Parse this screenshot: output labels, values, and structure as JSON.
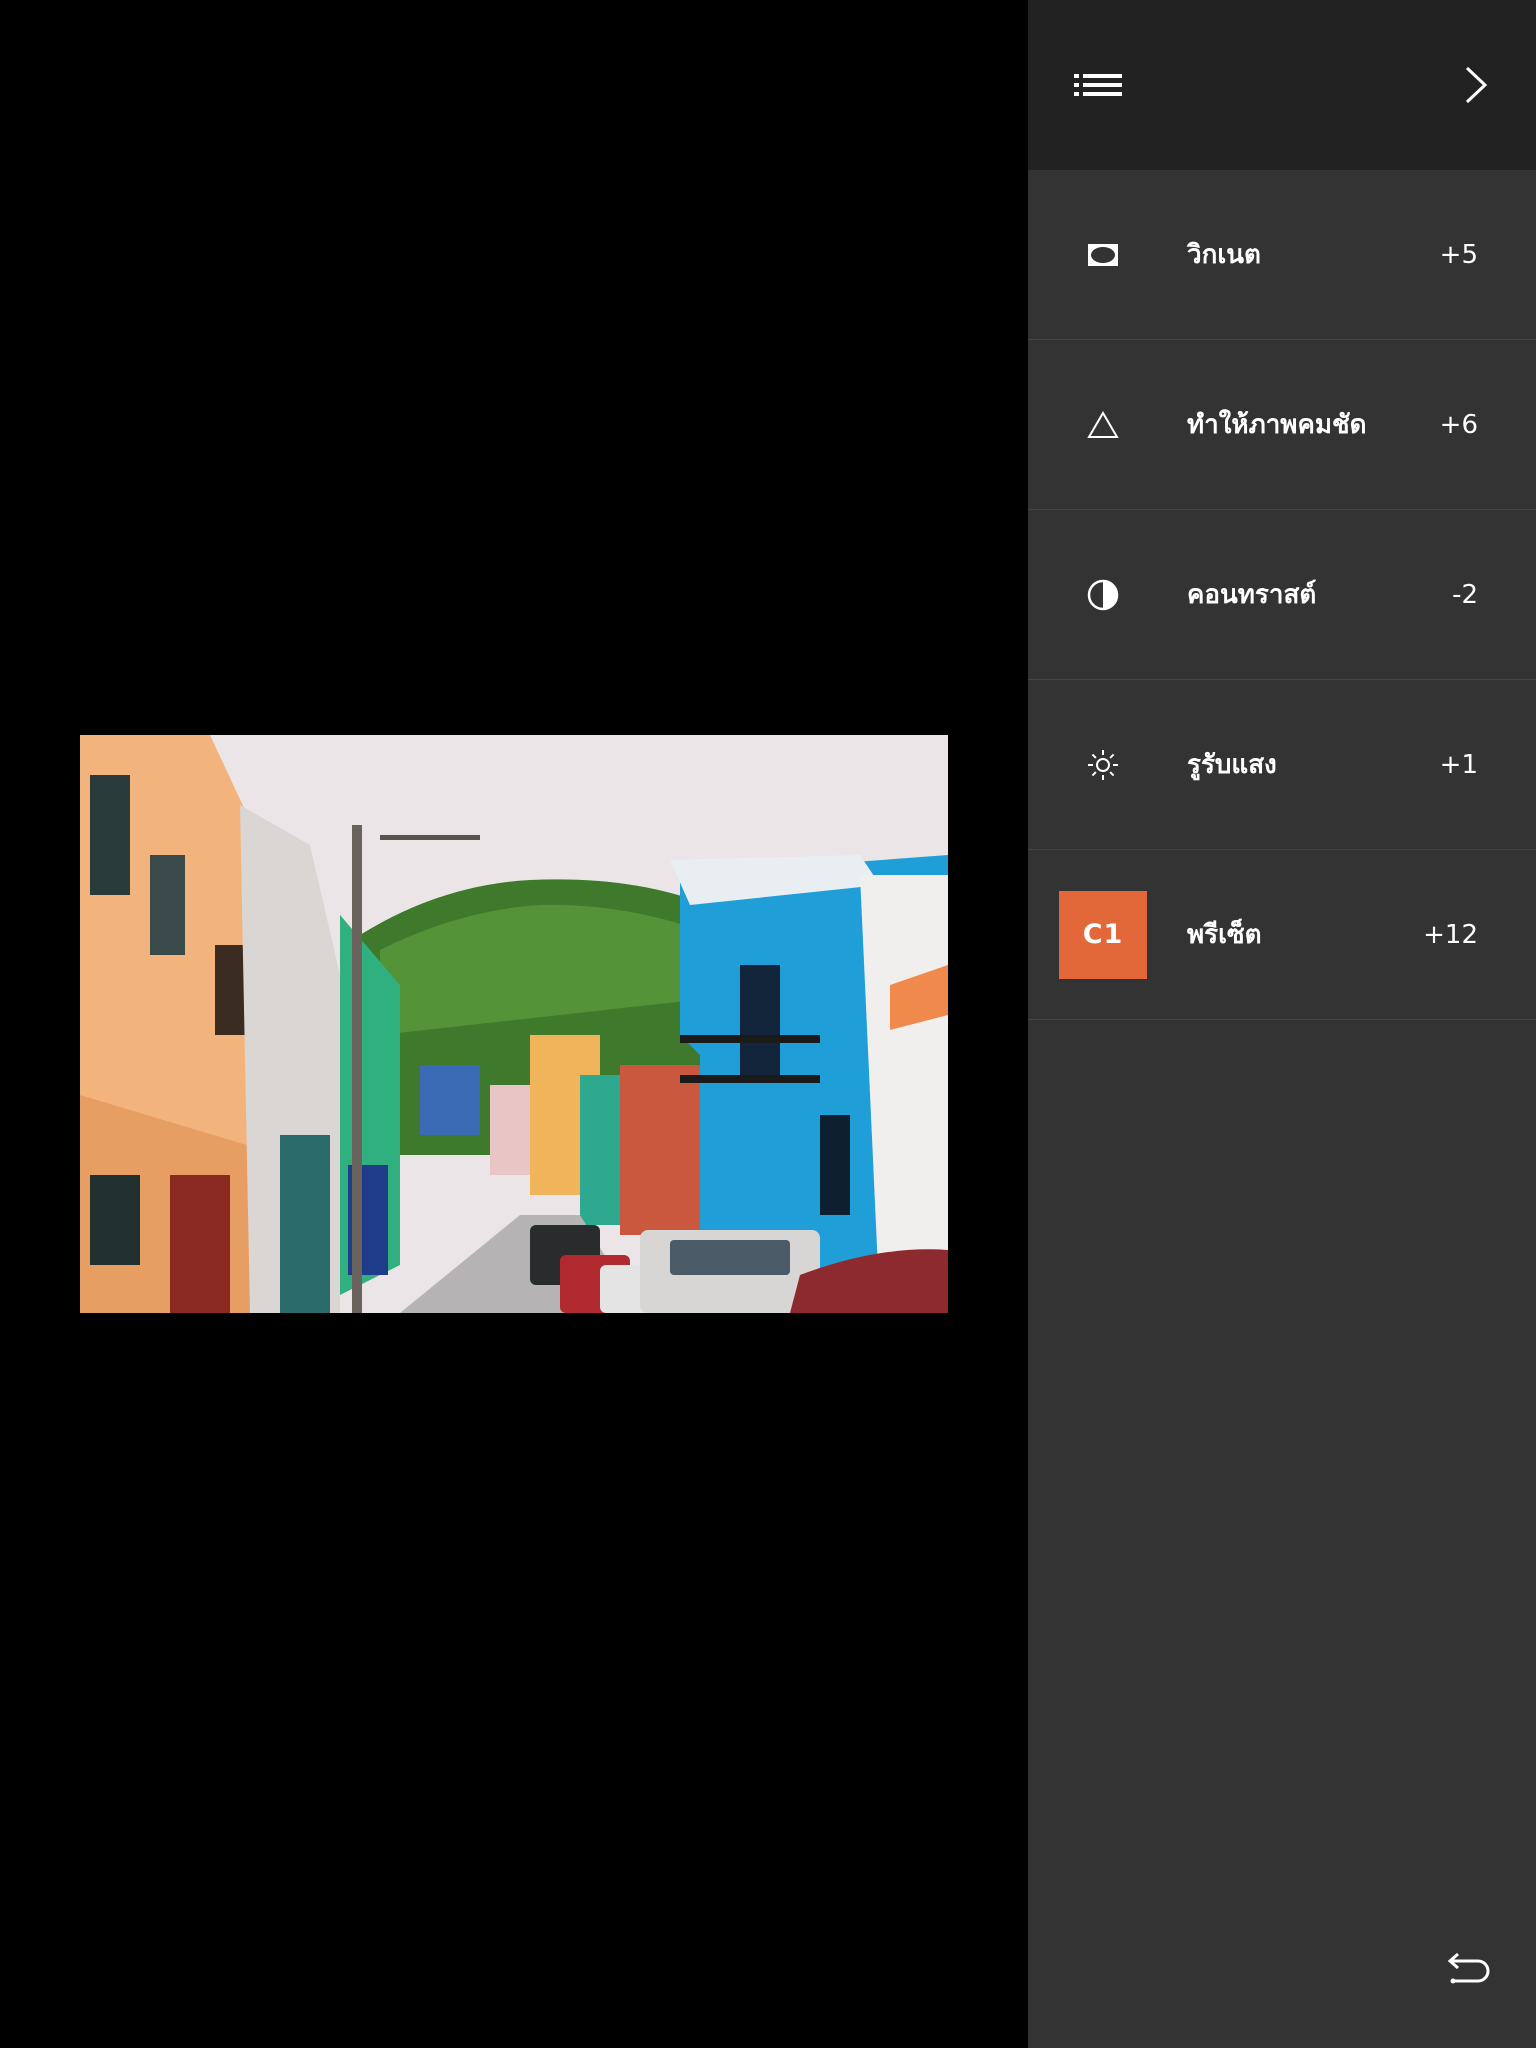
{
  "header": {
    "list_icon": "list-icon",
    "next_icon": "chevron-right-icon"
  },
  "adjustments": [
    {
      "icon": "vignette-icon",
      "label": "วิกเนต",
      "value": "+5"
    },
    {
      "icon": "sharpen-triangle-icon",
      "label": "ทำให้ภาพคมชัด",
      "value": "+6"
    },
    {
      "icon": "contrast-icon",
      "label": "คอนทราสต์",
      "value": "-2"
    },
    {
      "icon": "sun-exposure-icon",
      "label": "รูรับแสง",
      "value": "+1"
    },
    {
      "icon": "preset-badge",
      "badge": "C1",
      "label": "พรีเซ็ต",
      "value": "+12"
    }
  ],
  "footer": {
    "undo_icon": "undo-icon"
  },
  "colors": {
    "panel_bg": "#333333",
    "header_bg": "#222222",
    "accent_preset": "#e2683a",
    "divider": "#444444",
    "text": "#ffffff"
  }
}
